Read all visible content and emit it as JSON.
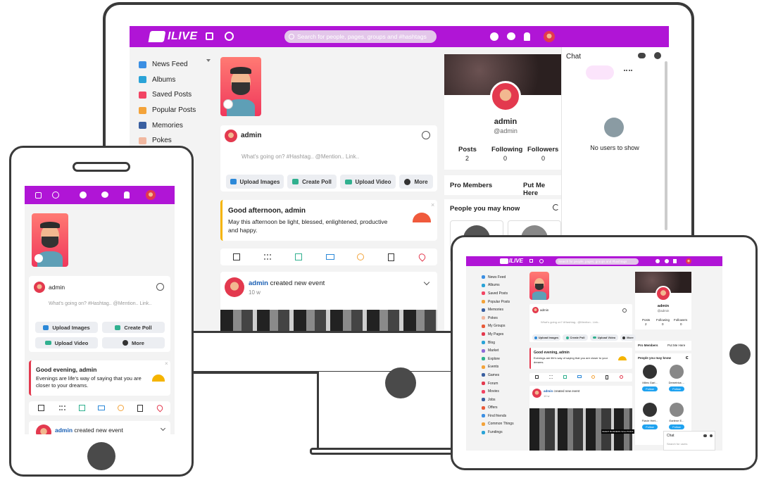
{
  "brand": {
    "logo_text": "ILIVE"
  },
  "desktop": {
    "search_placeholder": "Search for people, pages, groups and #hashtags",
    "sidebar": [
      {
        "label": "News Feed",
        "icon": "house-icon",
        "color": "#3b8fe3"
      },
      {
        "label": "Albums",
        "icon": "albums-icon",
        "color": "#2aa3d7"
      },
      {
        "label": "Saved Posts",
        "icon": "bookmark-icon",
        "color": "#f24463"
      },
      {
        "label": "Popular Posts",
        "icon": "fire-icon",
        "color": "#f3a33a"
      },
      {
        "label": "Memories",
        "icon": "memories-icon",
        "color": "#3a5fa0"
      },
      {
        "label": "Pokes",
        "icon": "poke-icon",
        "color": "#f1b8a0"
      }
    ],
    "composer": {
      "user": "admin",
      "placeholder": "What's going on? #Hashtag.. @Mention.. Link..",
      "upload_images": "Upload Images",
      "create_poll": "Create Poll",
      "upload_video": "Upload Video",
      "more": "More"
    },
    "greeting": {
      "title": "Good afternoon, admin",
      "text": "May this afternoon be light, blessed, enlightened, productive and happy."
    },
    "post": {
      "user": "admin",
      "action": "created new event",
      "time": "10 w"
    },
    "profile": {
      "name": "admin",
      "handle": "@admin",
      "posts_label": "Posts",
      "posts": "2",
      "following_label": "Following",
      "following": "0",
      "followers_label": "Followers",
      "followers": "0"
    },
    "pro_members": "Pro Members",
    "put_me_here": "Put Me Here",
    "people_you_may_know": "People you may know",
    "chat": {
      "title": "Chat",
      "empty": "No users to show"
    }
  },
  "phone": {
    "composer": {
      "user": "admin",
      "placeholder": "What's going on? #Hashtag.. @Mention.. Link..",
      "upload_images": "Upload Images",
      "create_poll": "Create Poll",
      "upload_video": "Upload Video",
      "more": "More"
    },
    "greeting": {
      "title": "Good evening, admin",
      "text": "Evenings are life's way of saying that you are closer to your dreams."
    },
    "post": {
      "user": "admin",
      "action": "created new event"
    }
  },
  "tablet": {
    "search_placeholder": "Search for people, pages, groups and #hashtags",
    "sidebar": [
      "News Feed",
      "Albums",
      "Saved Posts",
      "Popular Posts",
      "Memories",
      "Pokes",
      "My Groups",
      "My Pages",
      "Blog",
      "Market",
      "Explore",
      "Events",
      "Games",
      "Forum",
      "Movies",
      "Jobs",
      "Offers",
      "Find friends",
      "Common Things",
      "Fundings"
    ],
    "sidebar_colors": [
      "#3b8fe3",
      "#2aa3d7",
      "#f24463",
      "#f3a33a",
      "#3a5fa0",
      "#f1b8a0",
      "#e85b3a",
      "#e3394e",
      "#2aa3d7",
      "#8e6bd8",
      "#30b08f",
      "#f3a33a",
      "#3a5fa0",
      "#e3394e",
      "#f24463",
      "#3a5fa0",
      "#e85b3a",
      "#3b8fe3",
      "#f3a33a",
      "#2aa3d7"
    ],
    "composer": {
      "user": "admin",
      "placeholder": "What's going on? #Hashtag.. @Mention.. Link..",
      "upload_images": "Upload Images",
      "create_poll": "Create Poll",
      "upload_video": "Upload Video",
      "more": "More"
    },
    "greeting": {
      "title": "Good evening, admin",
      "text": "Evenings are life's way of saying that you are closer to your dreams."
    },
    "post": {
      "user": "admin",
      "action": "created new event",
      "time": "10 w"
    },
    "profile": {
      "name": "admin",
      "handle": "@admin",
      "posts_label": "Posts",
      "posts": "2",
      "following_label": "Following",
      "following": "0",
      "followers_label": "Followers",
      "followers": "0"
    },
    "pro_members": "Pro Members",
    "put_me_here": "Put Me Here",
    "people_you_may_know": "People you may know",
    "people": [
      {
        "name": "Miles Garl...",
        "follow": "Follow"
      },
      {
        "name": "Demetrius ...",
        "follow": "Follow"
      },
      {
        "name": "Flavie Hert...",
        "follow": "Follow"
      },
      {
        "name": "Earlene E...",
        "follow": "Follow"
      }
    ],
    "photo_caption": "SMART BUSINESS SOLUTIONS",
    "chat": {
      "title": "Chat",
      "search_placeholder": "Search for users"
    }
  },
  "colors": {
    "brand_purple": "#b015d6",
    "follow_blue": "#1ea2f0",
    "greeting_accent": "#f5b400"
  }
}
